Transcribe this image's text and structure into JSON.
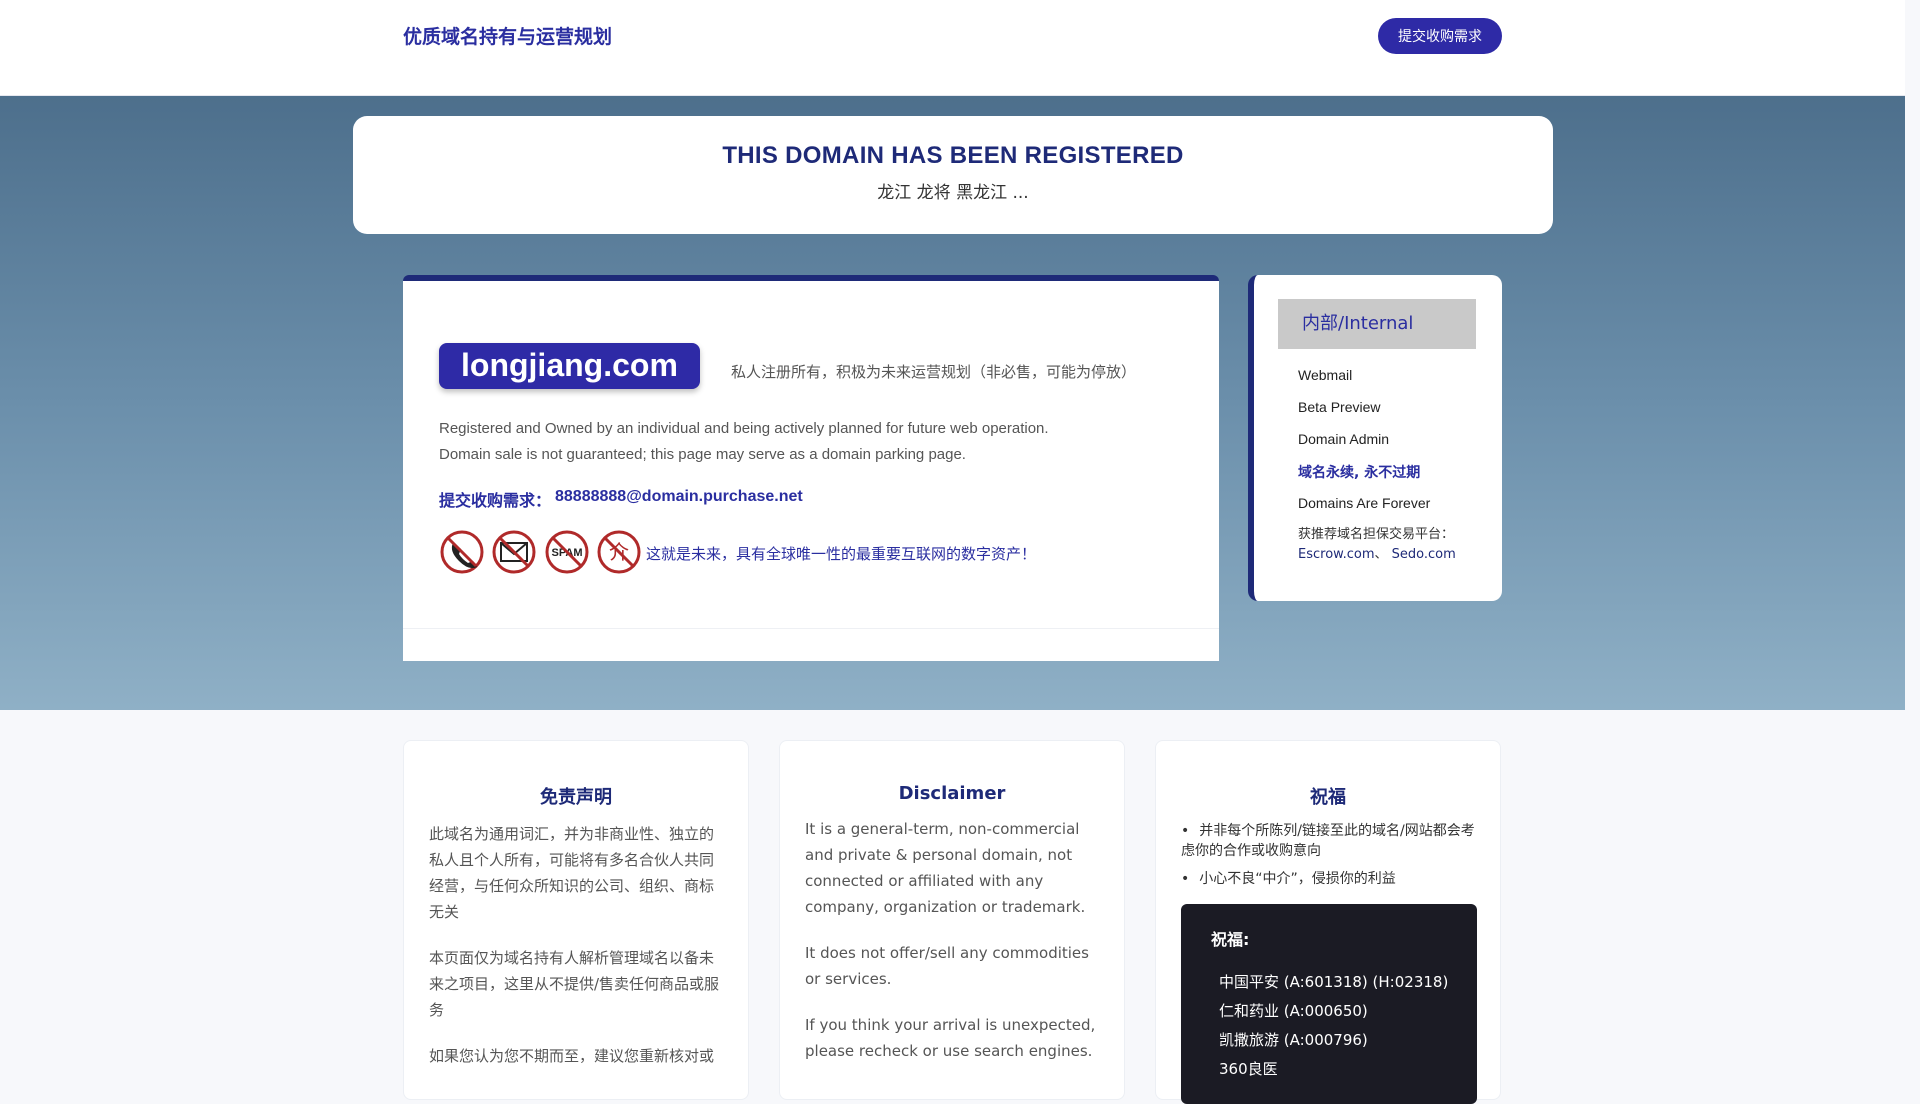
{
  "header": {
    "brand": "优质域名持有与运营规划",
    "submit_button": "提交收购需求"
  },
  "banner": {
    "title": "THIS DOMAIN HAS BEEN REGISTERED",
    "keywords": "龙江 龙将 黑龙江 ..."
  },
  "main": {
    "domain": "longjiang.com",
    "domain_desc": "私人注册所有，积极为未来运营规划（非必售，可能为停放）",
    "en_line_1": "Registered and Owned by an individual and being actively planned for future web operation.",
    "en_line_2": "Domain sale is not guaranteed; this page may serve as a domain parking page.",
    "contact_label": "提交收购需求：",
    "contact_email": "88888888@domain.purchase.net",
    "icons": [
      "no-phone-icon",
      "no-mail-icon",
      "no-spam-icon",
      "no-agent-icon"
    ],
    "icon_spam_text": "SPAM",
    "icon_agent_text": "介",
    "future_text": "这就是未来，具有全球唯一性的最重要互联网的数字资产！"
  },
  "sidebar": {
    "heading": "内部/Internal",
    "links": [
      "Webmail",
      "Beta Preview",
      "Domain Admin",
      "域名永续, 永不过期",
      "Domains Are Forever"
    ],
    "note_prefix": "获推荐域名担保交易平台：",
    "escrow": "Escrow.com",
    "separator": "、",
    "sedo": "Sedo.com"
  },
  "disclaimer_cn": {
    "title": "免责声明",
    "p1": "此域名为通用词汇，并为非商业性、独立的私人且个人所有，可能将有多名合伙人共同经营，与任何众所知识的公司、组织、商标无关",
    "p2": "本页面仅为域名持有人解析管理域名以备未来之项目，这里从不提供/售卖任何商品或服务",
    "p3": "如果您认为您不期而至，建议您重新核对或"
  },
  "disclaimer_en": {
    "title": "Disclaimer",
    "p1": "It is a general-term, non-commercial and private & personal domain, not connected or affiliated with any company, organization or trademark.",
    "p2": "It does not offer/sell any commodities or services.",
    "p3": "If you think your arrival is unexpected, please recheck or use search engines."
  },
  "blessing": {
    "title": "祝福",
    "bullets": [
      "并非每个所陈列/链接至此的域名/网站都会考虑你的合作或收购意向",
      "小心不良“中介”，侵损你的利益"
    ],
    "box_title": "祝福:",
    "items": [
      "中国平安 (A:601318) (H:02318)",
      "仁和药业 (A:000650)",
      "凯撒旅游 (A:000796)",
      "360良医"
    ]
  },
  "colors": {
    "brand": "#2e2aa6",
    "title": "#1e2a78",
    "hero_top": "#4d6f8c",
    "hero_bottom": "#8fb0c6",
    "dark_box": "#1b1b24"
  }
}
